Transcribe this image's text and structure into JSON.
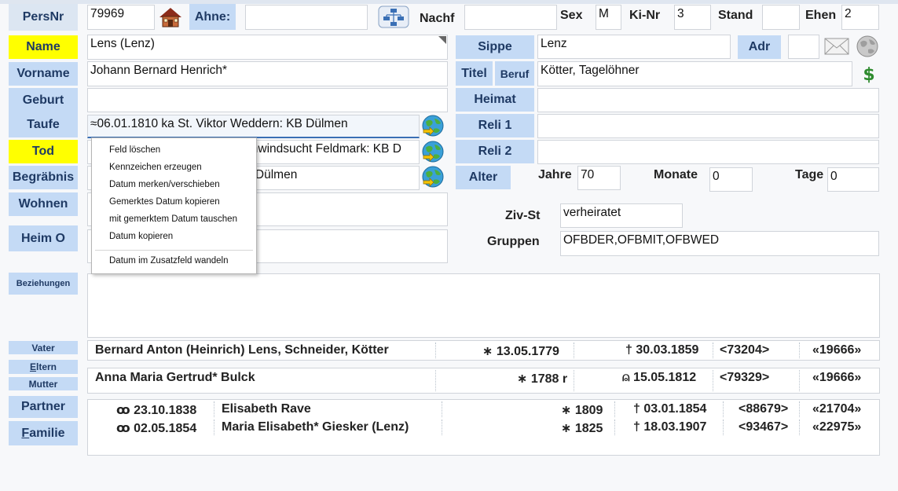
{
  "labels": {
    "persnr": "PersNr",
    "ahne": "Ahne:",
    "nachf": "Nachf",
    "sex": "Sex",
    "kinr": "Ki-Nr",
    "stand": "Stand",
    "ehen": "Ehen",
    "name": "Name",
    "vorname": "Vorname",
    "geburt": "Geburt",
    "taufe": "Taufe",
    "tod": "Tod",
    "begraebnis": "Begräbnis",
    "wohnen": "Wohnen",
    "heim": "Heim O",
    "beziehungen": "Beziehungen",
    "sippe": "Sippe",
    "adr": "Adr",
    "titel": "Titel",
    "beruf": "Beruf",
    "heimat": "Heimat",
    "reli1": "Reli 1",
    "reli2": "Reli 2",
    "alter": "Alter",
    "jahre": "Jahre",
    "monate": "Monate",
    "tage": "Tage",
    "zivst": "Ziv-St",
    "gruppen": "Gruppen",
    "vater": "Vater",
    "eltern_first": "E",
    "eltern_rest": "ltern",
    "mutter": "Mutter",
    "partner": "Partner",
    "familie_first": "F",
    "familie_rest": "amilie"
  },
  "values": {
    "persnr": "79969",
    "ahne": "",
    "nachf": "",
    "sex": "M",
    "kinr": "3",
    "stand": "",
    "ehen": "2",
    "name": "Lens (Lenz)",
    "vorname": "Johann Bernard Henrich*",
    "geburt": "",
    "taufe": "≈06.01.1810 ka St. Viktor Weddern: KB Dülmen",
    "tod": "chwindsucht Feldmark: KB D",
    "begraebnis": "3 Dülmen",
    "sippe": "Lenz",
    "adr": "",
    "beruf": "Kötter, Tagelöhner",
    "heimat": "",
    "reli1": "",
    "reli2": "",
    "jahre": "70",
    "monate": "0",
    "tage": "0",
    "zivst": "verheiratet",
    "gruppen": "OFBDER,OFBMIT,OFBWED"
  },
  "father": {
    "name": "Bernard Anton (Heinrich) Lens, Schneider, Kötter",
    "birth": "∗ 13.05.1779",
    "death": "† 30.03.1859",
    "id": "<73204>",
    "family": "«19666»"
  },
  "mother": {
    "name": "Anna Maria Gertrud* Bulck",
    "birth": "∗ 1788 r",
    "death": "⍝ 15.05.1812",
    "id": "<79329>",
    "family": "«19666»"
  },
  "partners": [
    {
      "marriage": "ꝏ 23.10.1838",
      "name": "Elisabeth Rave",
      "birth": "∗ 1809",
      "death": "† 03.01.1854",
      "id": "<88679>",
      "family": "«21704»"
    },
    {
      "marriage": "ꝏ 02.05.1854",
      "name": "Maria Elisabeth* Giesker (Lenz)",
      "birth": "∗ 1825",
      "death": "† 18.03.1907",
      "id": "<93467>",
      "family": "«22975»"
    }
  ],
  "context_menu": {
    "items": [
      "Feld löschen",
      "Kennzeichen erzeugen",
      "Datum merken/verschieben",
      "Gemerktes Datum kopieren",
      "mit gemerktem Datum tauschen",
      "Datum kopieren",
      "Datum im Zusatzfeld wandeln"
    ]
  },
  "icons": {
    "house": "house-icon",
    "tree": "family-tree-icon",
    "mail": "envelope-icon",
    "globe": "globe-icon",
    "dollar": "dollar-icon",
    "world": "world-arrow-icon"
  },
  "colors": {
    "label_bg": "#c4daf5",
    "highlight": "#ffff00",
    "label_text": "#1f3a64"
  }
}
